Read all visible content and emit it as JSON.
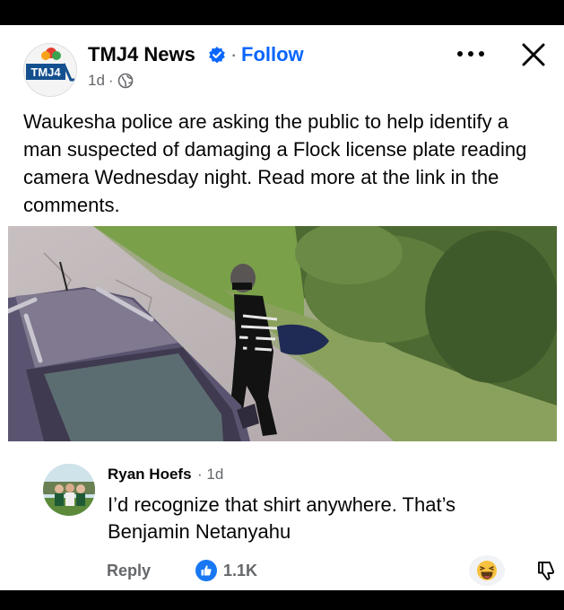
{
  "post": {
    "page_name": "TMJ4 News",
    "follow_label": "Follow",
    "time": "1d",
    "logo_text": "TMJ4",
    "text": "Waukesha police are asking the public to help identify a man suspected of damaging a Flock license plate reading camera Wednesday night. Read more at the link in the comments.",
    "image_subject": "surveillance-photo-man-with-bag-near-car"
  },
  "comment": {
    "author": "Ryan Hoefs",
    "time": "1d",
    "text": "I’d recognize that shirt anywhere. That’s Benjamin Netanyahu",
    "reply_label": "Reply",
    "like_count": "1.1K"
  },
  "colors": {
    "link_blue": "#0866ff",
    "secondary_text": "#65676b",
    "verified_badge": "#0866ff",
    "like_blue": "#1877f2"
  },
  "icons": [
    "verified-badge-icon",
    "globe-icon",
    "more-options-icon",
    "close-icon",
    "like-icon",
    "haha-reaction-icon",
    "dislike-icon"
  ]
}
